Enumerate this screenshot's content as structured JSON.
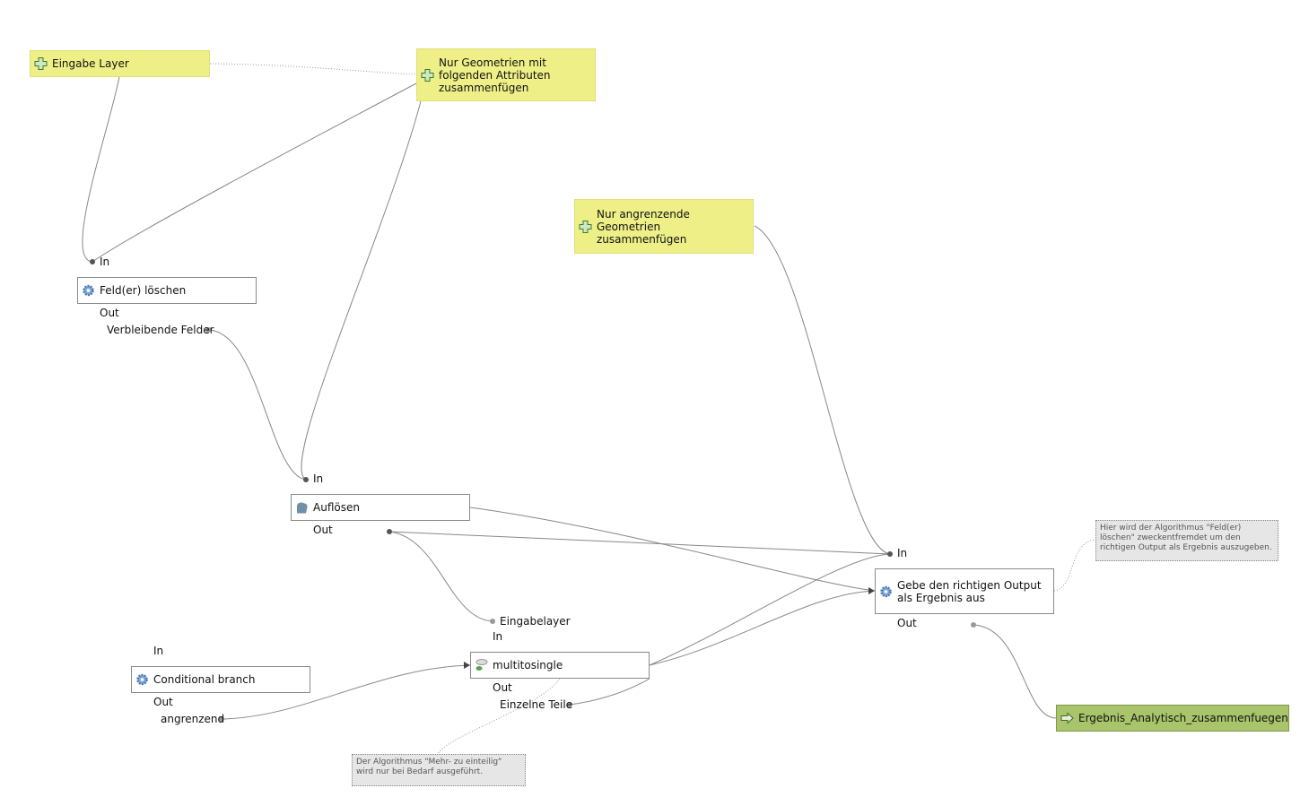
{
  "inputs": {
    "eingabe_layer": "Eingabe Layer",
    "nur_geometrien": "Nur Geometrien mit folgenden Attributen zusammenfügen",
    "nur_angrenzende": "Nur angrenzende Geometrien zusammenfügen"
  },
  "algorithms": {
    "feld_loeschen": {
      "title": "Feld(er) löschen",
      "in": "In",
      "out": "Out",
      "output": "Verbleibende Felder"
    },
    "aufloesen": {
      "title": "Auflösen",
      "in": "In",
      "out": "Out"
    },
    "multitosingle": {
      "title": "multitosingle",
      "in_param": "Eingabelayer",
      "in": "In",
      "out": "Out",
      "output": "Einzelne Teile"
    },
    "conditional": {
      "title": "Conditional branch",
      "in": "In",
      "out": "Out",
      "output": "angrenzend"
    },
    "gebe": {
      "title": "Gebe den richtigen Output als Ergebnis aus",
      "in": "In",
      "out": "Out"
    }
  },
  "output": {
    "title": "Ergebnis_Analytisch_zusammenfuegen"
  },
  "comments": {
    "c1": "Hier wird der Algorithmus \"Feld(er) löschen\" zweckentfremdet um den richtigen Output als Ergebnis auszugeben.",
    "c2": "Der Algorithmus \"Mehr- zu einteilig\" wird nur bei Bedarf ausgeführt."
  },
  "colors": {
    "input": "#eef087",
    "output": "#a9c46a",
    "comment": "#e6e6e6"
  }
}
